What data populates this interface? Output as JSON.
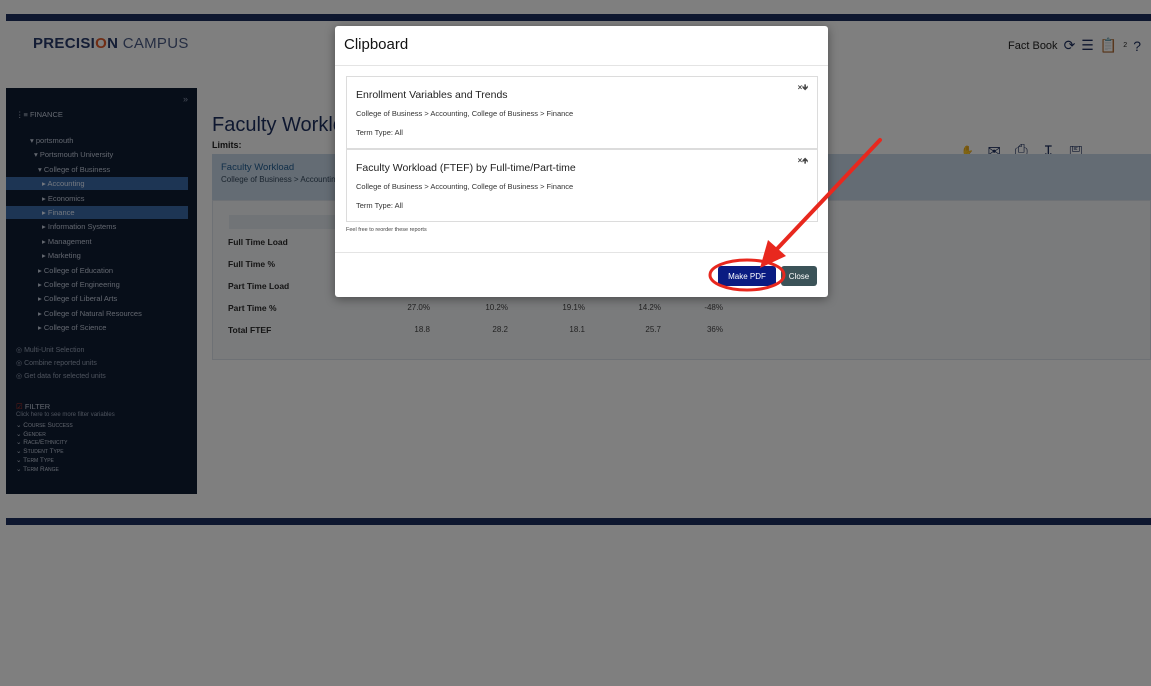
{
  "app": {
    "logo_part1": "PRECISI",
    "logo_o": "O",
    "logo_part2": "N",
    "logo_campus": " CAMPUS",
    "factbook_label": "Fact Book",
    "clipboard_count": "2"
  },
  "sidebar": {
    "collapse_glyph": "»",
    "title": "FINANCE",
    "tree": [
      {
        "label": "portsmouth",
        "indent": 0,
        "arrow": "▾",
        "selected": false
      },
      {
        "label": "Portsmouth University",
        "indent": 1,
        "arrow": "▾",
        "selected": false
      },
      {
        "label": "College of Business",
        "indent": 2,
        "arrow": "▾",
        "selected": false
      },
      {
        "label": "Accounting",
        "indent": 3,
        "arrow": "▸",
        "selected": true
      },
      {
        "label": "Economics",
        "indent": 3,
        "arrow": "▸",
        "selected": false
      },
      {
        "label": "Finance",
        "indent": 3,
        "arrow": "▸",
        "selected": true
      },
      {
        "label": "Information Systems",
        "indent": 3,
        "arrow": "▸",
        "selected": false
      },
      {
        "label": "Management",
        "indent": 3,
        "arrow": "▸",
        "selected": false
      },
      {
        "label": "Marketing",
        "indent": 3,
        "arrow": "▸",
        "selected": false
      },
      {
        "label": "College of Education",
        "indent": 2,
        "arrow": "▸",
        "selected": false
      },
      {
        "label": "College of Engineering",
        "indent": 2,
        "arrow": "▸",
        "selected": false
      },
      {
        "label": "College of Liberal Arts",
        "indent": 2,
        "arrow": "▸",
        "selected": false
      },
      {
        "label": "College of Natural Resources",
        "indent": 2,
        "arrow": "▸",
        "selected": false
      },
      {
        "label": "College of Science",
        "indent": 2,
        "arrow": "▸",
        "selected": false
      }
    ],
    "options": [
      "Multi-Unit Selection",
      "Combine reported units",
      "Get data for selected units"
    ],
    "filter_title": "FILTER",
    "filter_subtitle": "Click here to see more filter variables",
    "filters": [
      "Course Success",
      "Gender",
      "Race/Ethnicity",
      "Student Type",
      "Term Type",
      "Term Range"
    ]
  },
  "main": {
    "title": "Faculty Workload (FTEF) by Full-time/Part-time",
    "limits_label": "Limits:",
    "report_title": "Faculty Workload",
    "report_subtitle": "College of Business > Accounting, College of Business > Finance",
    "rows": [
      {
        "label": "Full Time Load",
        "values": []
      },
      {
        "label": "Full Time %",
        "values": []
      },
      {
        "label": "Part Time Load",
        "values": []
      },
      {
        "label": "Part Time %",
        "values": [
          "27.0%",
          "10.2%",
          "19.1%",
          "14.2%",
          "-48%"
        ]
      },
      {
        "label": "Total FTEF",
        "values": [
          "18.8",
          "28.2",
          "18.1",
          "25.7",
          "36%"
        ]
      }
    ]
  },
  "modal": {
    "title": "Clipboard",
    "items": [
      {
        "title": "Enrollment Variables and Trends",
        "units": "College of Business > Accounting, College of Business > Finance",
        "term": "Term Type: All",
        "controls": "×🡻"
      },
      {
        "title": "Faculty Workload (FTEF) by Full-time/Part-time",
        "units": "College of Business > Accounting, College of Business > Finance",
        "term": "Term Type: All",
        "controls": "×🡹"
      }
    ],
    "reorder_note": "Feel free to reorder these reports",
    "make_pdf_label": "Make PDF",
    "close_label": "Close"
  },
  "colors": {
    "brand_navy": "#1c2e5e",
    "logo_accent": "#e05a2a",
    "annotation_red": "#e8281e",
    "pdf_button": "#0a1b82",
    "close_button": "#3b5358"
  }
}
